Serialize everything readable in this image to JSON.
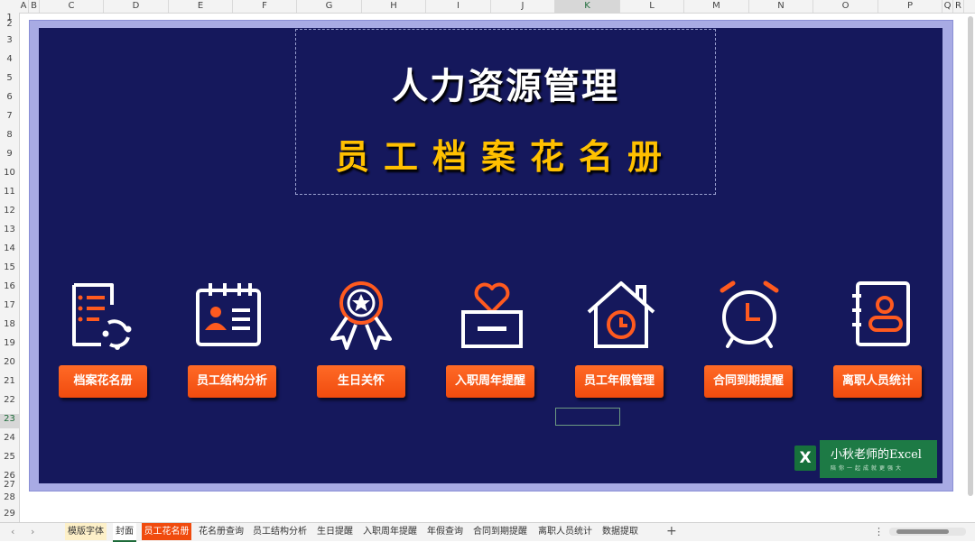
{
  "columns": [
    "A",
    "B",
    "C",
    "D",
    "E",
    "F",
    "G",
    "H",
    "I",
    "J",
    "K",
    "L",
    "M",
    "N",
    "O",
    "P",
    "Q",
    "R"
  ],
  "selected_column": "K",
  "rows": [
    "1",
    "2",
    "3",
    "4",
    "5",
    "6",
    "7",
    "8",
    "9",
    "10",
    "11",
    "12",
    "13",
    "14",
    "15",
    "16",
    "17",
    "18",
    "19",
    "20",
    "21",
    "22",
    "23",
    "24",
    "25",
    "26",
    "27",
    "28",
    "29"
  ],
  "selected_row": "23",
  "title": {
    "line1": "人力资源管理",
    "line2": "员工档案花名册"
  },
  "buttons": [
    {
      "label": "档案花名册",
      "icon": "document-list-icon"
    },
    {
      "label": "员工结构分析",
      "icon": "id-card-calendar-icon"
    },
    {
      "label": "生日关怀",
      "icon": "award-medal-icon"
    },
    {
      "label": "入职周年提醒",
      "icon": "heart-box-icon"
    },
    {
      "label": "员工年假管理",
      "icon": "house-clock-icon"
    },
    {
      "label": "合同到期提醒",
      "icon": "alarm-clock-icon"
    },
    {
      "label": "离职人员统计",
      "icon": "contact-book-icon"
    }
  ],
  "logo": {
    "main": "小秋老师的Excel",
    "sub": "陪你一起成就更强大"
  },
  "tabs": [
    {
      "label": "模版字体",
      "state": "tan"
    },
    {
      "label": "封面",
      "state": "active"
    },
    {
      "label": "员工花名册",
      "state": "orange"
    },
    {
      "label": "花名册查询",
      "state": "normal"
    },
    {
      "label": "员工结构分析",
      "state": "normal"
    },
    {
      "label": "生日提醒",
      "state": "normal"
    },
    {
      "label": "入职周年提醒",
      "state": "normal"
    },
    {
      "label": "年假查询",
      "state": "normal"
    },
    {
      "label": "合同到期提醒",
      "state": "normal"
    },
    {
      "label": "离职人员统计",
      "state": "normal"
    },
    {
      "label": "数据提取",
      "state": "normal"
    }
  ],
  "add_sheet": "+",
  "more_menu": "⋮",
  "colors": {
    "panel": "#15185c",
    "frame": "#a8abe4",
    "accent_orange": "#f04b0e",
    "title_gold": "#ffc000"
  }
}
